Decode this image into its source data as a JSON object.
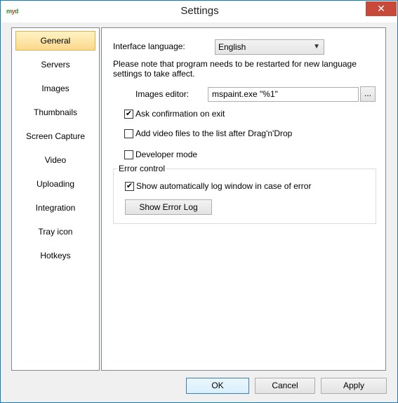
{
  "window": {
    "title": "Settings",
    "icon_text": "myd"
  },
  "sidebar": {
    "items": [
      {
        "label": "General"
      },
      {
        "label": "Servers"
      },
      {
        "label": "Images"
      },
      {
        "label": "Thumbnails"
      },
      {
        "label": "Screen Capture"
      },
      {
        "label": "Video"
      },
      {
        "label": "Uploading"
      },
      {
        "label": "Integration"
      },
      {
        "label": "Tray icon"
      },
      {
        "label": "Hotkeys"
      }
    ]
  },
  "general": {
    "language_label": "Interface language:",
    "language_value": "English",
    "restart_note": "Please note that program needs to be restarted for new language settings to take affect.",
    "editor_label": "Images editor:",
    "editor_value": "mspaint.exe \"%1\"",
    "browse_label": "...",
    "ask_confirm_label": "Ask confirmation on exit",
    "ask_confirm_checked": true,
    "add_video_label": "Add video files to the list after Drag'n'Drop",
    "add_video_checked": false,
    "dev_mode_label": "Developer mode",
    "dev_mode_checked": false,
    "error_group_title": "Error control",
    "show_log_label": "Show automatically log window in case of error",
    "show_log_checked": true,
    "show_error_log_button": "Show Error Log"
  },
  "footer": {
    "ok": "OK",
    "cancel": "Cancel",
    "apply": "Apply"
  }
}
